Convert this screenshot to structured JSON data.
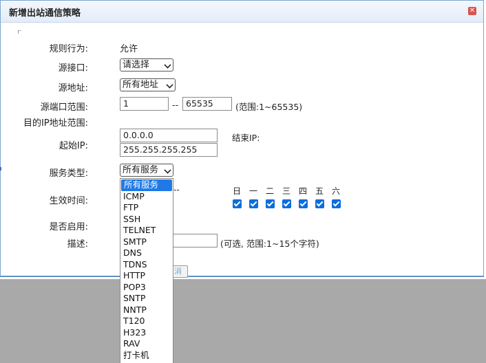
{
  "dialog": {
    "title": "新增出站通信策略",
    "close_icon": "close-icon"
  },
  "form": {
    "rule_action_label": "规则行为:",
    "rule_action_value": "允许",
    "src_iface_label": "源接口:",
    "src_iface_value": "请选择",
    "src_addr_label": "源地址:",
    "src_addr_value": "所有地址",
    "src_port_label": "源端口范围:",
    "src_port_start": "1",
    "src_port_sep": "--",
    "src_port_end": "65535",
    "src_port_hint": "(范围:1~65535)",
    "dest_ip_label": "目的IP地址范围:",
    "start_ip_label": "起始IP:",
    "start_ip_value": "0.0.0.0",
    "end_ip_label": "结束IP:",
    "end_ip_value": "255.255.255.255",
    "service_label": "服务类型:",
    "service_value": "所有服务",
    "effective_time_label": "生效时间:",
    "time_sep": "--",
    "enabled_label": "是否启用:",
    "description_label": "描述:",
    "description_hint": "(可选, 范围:1~15个字符)",
    "cancel_button_partial": "消"
  },
  "weekdays": [
    "日",
    "一",
    "二",
    "三",
    "四",
    "五",
    "六"
  ],
  "weekdays_checked": [
    true,
    true,
    true,
    true,
    true,
    true,
    true
  ],
  "service_options": [
    "所有服务",
    "ICMP",
    "FTP",
    "SSH",
    "TELNET",
    "SMTP",
    "DNS",
    "TDNS",
    "HTTP",
    "POP3",
    "SNTP",
    "NNTP",
    "T120",
    "H323",
    "RAV",
    "打卡机"
  ],
  "colors": {
    "accent": "#1f7ae8",
    "checkbox": "#0a6ede",
    "overlay": "#a9a9a9",
    "border": "#7aa6d3"
  }
}
